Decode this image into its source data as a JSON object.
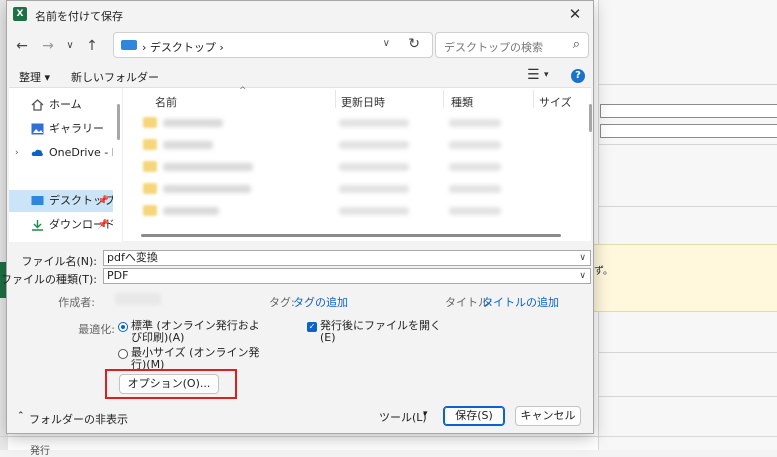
{
  "dialog": {
    "title": "名前を付けて保存",
    "app_icon_letter": "X",
    "close_glyph": "✕"
  },
  "nav": {
    "back": "←",
    "forward": "→",
    "recent": "∨",
    "up": "↑",
    "breadcrumb": "›  デスクトップ  ›",
    "dropdown": "∨",
    "refresh": "↻"
  },
  "search": {
    "placeholder": "デスクトップの検索",
    "icon": "⌕"
  },
  "toolbar": {
    "organize": "整理 ▾",
    "new_folder": "新しいフォルダー",
    "view_icon": "☰",
    "view_chevron": "▾",
    "help": "?"
  },
  "sidebar": {
    "items": [
      {
        "label": "ホーム",
        "icon": "home-icon"
      },
      {
        "label": "ギャラリー",
        "icon": "gallery-icon"
      },
      {
        "label": "OneDrive - Perso",
        "icon": "cloud-icon",
        "expand": "›"
      },
      {
        "label": "デスクトップ",
        "icon": "desktop-icon",
        "selected": true,
        "pin": "📌"
      },
      {
        "label": "ダウンロード",
        "icon": "download-icon",
        "pin": "📌"
      }
    ]
  },
  "columns": {
    "name": "名前",
    "modified": "更新日時",
    "type": "種類",
    "size": "サイズ",
    "sort_caret": "^"
  },
  "form": {
    "filename_label": "ファイル名(N):",
    "filename_value": "pdfへ変換",
    "filetype_label": "ファイルの種類(T):",
    "filetype_value": "PDF",
    "author_label": "作成者:",
    "tags_label": "タグ:",
    "tags_link": "タグの追加",
    "title_label": "タイトル:",
    "title_link": "タイトルの追加",
    "optimize_label": "最適化:",
    "radio_standard_1": "標準 (オンライン発行およ",
    "radio_standard_2": "び印刷)(A)",
    "radio_min_1": "最小サイズ (オンライン発",
    "radio_min_2": "行)(M)",
    "open_after_1": "発行後にファイルを開く",
    "open_after_2": "(E)",
    "options_button": "オプション(O)...",
    "chev": "∨"
  },
  "footer": {
    "hide_folders": "フォルダーの非表示",
    "hide_chevron": "⌃",
    "tools": "ツール(L)",
    "tools_chev": "▾",
    "save": "保存(S)",
    "cancel": "キャンセル"
  },
  "background": {
    "warn_text": "ず。",
    "bottom_text": "発行"
  },
  "colors": {
    "accent": "#0a63c9",
    "excel_green": "#1e7145",
    "highlight": "#e01e1e",
    "selected": "#cce4f7"
  }
}
